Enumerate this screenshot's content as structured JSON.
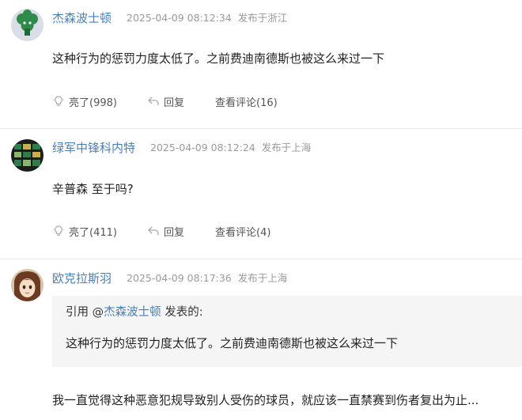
{
  "comments": [
    {
      "username": "杰森波士顿",
      "time": "2025-04-09 08:12:34",
      "location": "发布于浙江",
      "text": "这种行为的惩罚力度太低了。之前费迪南德斯也被这么来过一下",
      "likes_label": "亮了(998)",
      "reply_label": "回复",
      "view_replies_label": "查看评论(16)"
    },
    {
      "username": "绿军中锋科内特",
      "time": "2025-04-09 08:12:24",
      "location": "发布于上海",
      "text": "辛普森 至于吗?",
      "likes_label": "亮了(411)",
      "reply_label": "回复",
      "view_replies_label": "查看评论(4)"
    },
    {
      "username": "欧克拉斯羽",
      "time": "2025-04-09 08:17:36",
      "location": "发布于上海",
      "quote": {
        "prefix": "引用 @",
        "quoted_user": "杰森波士顿",
        "suffix": " 发表的:",
        "text": "这种行为的惩罚力度太低了。之前费迪南德斯也被这么来过一下"
      },
      "text": "我一直觉得这种恶意犯规导致别人受伤的球员，就应该一直禁赛到伤者复出为止..."
    }
  ],
  "icons": {
    "like": "lightbulb-icon",
    "reply": "reply-arrow-icon"
  },
  "colors": {
    "username": "#4a7fb5",
    "meta": "#9a9a9a",
    "quote_background": "#f5f5f5",
    "divider": "#e8e8e8"
  }
}
